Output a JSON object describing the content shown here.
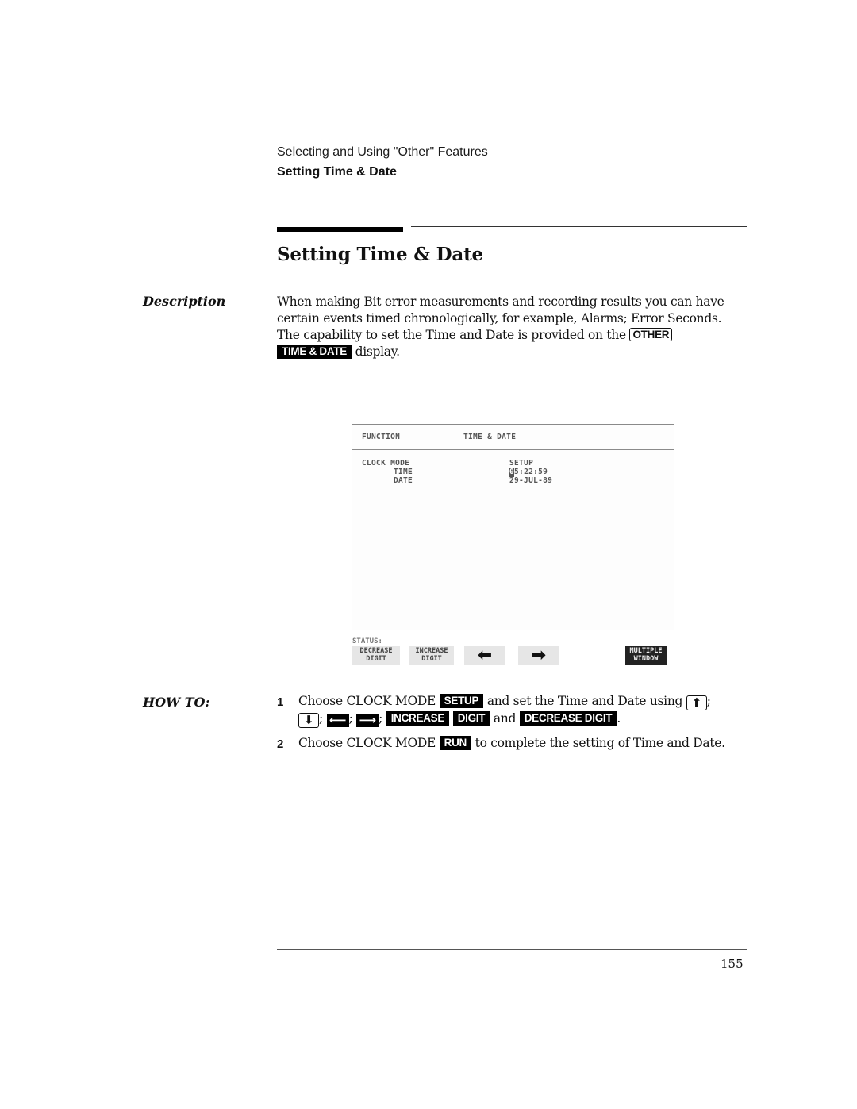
{
  "header": {
    "section": "Selecting and Using \"Other\" Features",
    "subsection": "Setting Time & Date"
  },
  "title": "Setting Time & Date",
  "description": {
    "label": "Description",
    "para1": "When making Bit error measurements and recording results you can have certain events timed chronologically, for example, Alarms; Error Seconds.",
    "para2_before": "The capability to set the Time and Date is provided on the",
    "key_other": "OTHER",
    "key_time_date": "TIME & DATE",
    "para2_after": "display."
  },
  "screen": {
    "function_label": "FUNCTION",
    "function_value": "TIME & DATE",
    "rows": [
      {
        "label": "CLOCK MODE",
        "value": "SETUP"
      },
      {
        "label": "TIME",
        "value_cursor": "0",
        "value": "5:22:59"
      },
      {
        "label": "DATE",
        "value": "29-JUL-89"
      }
    ],
    "status_label": "STATUS:",
    "softkeys": [
      {
        "line1": "DECREASE",
        "line2": "DIGIT"
      },
      {
        "line1": "INCREASE",
        "line2": "DIGIT"
      },
      {
        "icon": "left-arrow",
        "glyph": "⬅"
      },
      {
        "icon": "right-arrow",
        "glyph": "➡"
      },
      {
        "line1": "MULTIPLE",
        "line2": "WINDOW"
      }
    ]
  },
  "howto": {
    "label": "HOW TO:",
    "step1": {
      "num": "1",
      "t1": "Choose CLOCK MODE",
      "key_setup": "SETUP",
      "t2": "and set the Time and Date using",
      "up": "⬆",
      "down": "⬇",
      "left": "⟵",
      "right": "⟶",
      "key_increase": "INCREASE",
      "key_digit": "DIGIT",
      "t3": "and",
      "key_decrease_digit": "DECREASE DIGIT"
    },
    "step2": {
      "num": "2",
      "t1": "Choose CLOCK MODE",
      "key_run": "RUN",
      "t2": "to complete the setting of Time and Date."
    }
  },
  "footer": {
    "page_number": "155"
  }
}
